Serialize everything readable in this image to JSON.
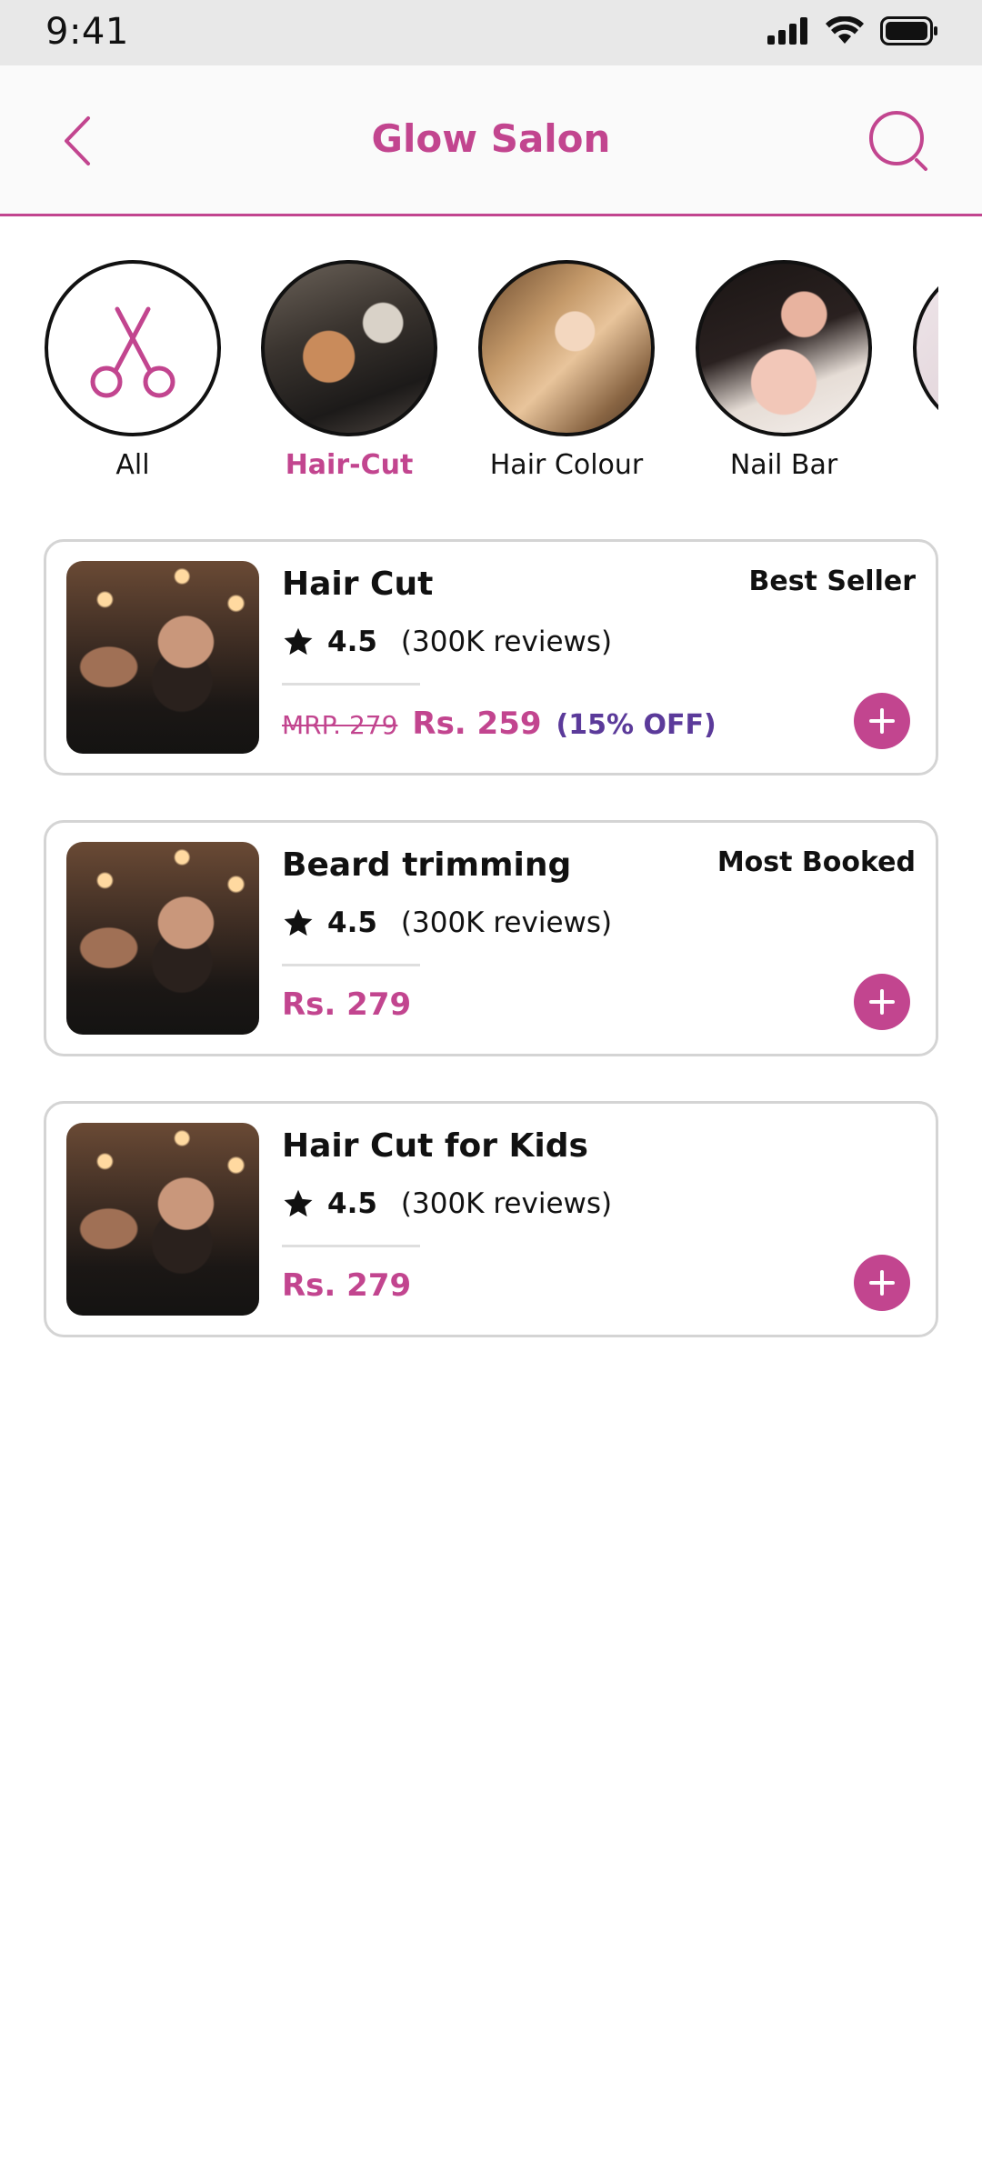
{
  "status_bar": {
    "time": "9:41"
  },
  "header": {
    "title": "Glow Salon"
  },
  "colors": {
    "brand": "#c2458f",
    "discount": "#5b3a9a"
  },
  "categories": [
    {
      "label": "All",
      "icon": "scissors-icon",
      "active": false
    },
    {
      "label": "Hair-Cut",
      "icon": "haircut-photo",
      "active": true
    },
    {
      "label": "Hair Colour",
      "icon": "hair-colour-photo",
      "active": false
    },
    {
      "label": "Nail Bar",
      "icon": "nail-bar-photo",
      "active": false
    }
  ],
  "services": [
    {
      "title": "Hair Cut",
      "badge": "Best Seller",
      "rating": "4.5",
      "reviews": "(300K reviews)",
      "mrp": "MRP. 279",
      "price": "Rs. 259",
      "discount": "(15% OFF)"
    },
    {
      "title": "Beard trimming",
      "badge": "Most Booked",
      "rating": "4.5",
      "reviews": "(300K reviews)",
      "price": "Rs. 279"
    },
    {
      "title": "Hair Cut for Kids",
      "rating": "4.5",
      "reviews": "(300K reviews)",
      "price": "Rs. 279"
    }
  ]
}
